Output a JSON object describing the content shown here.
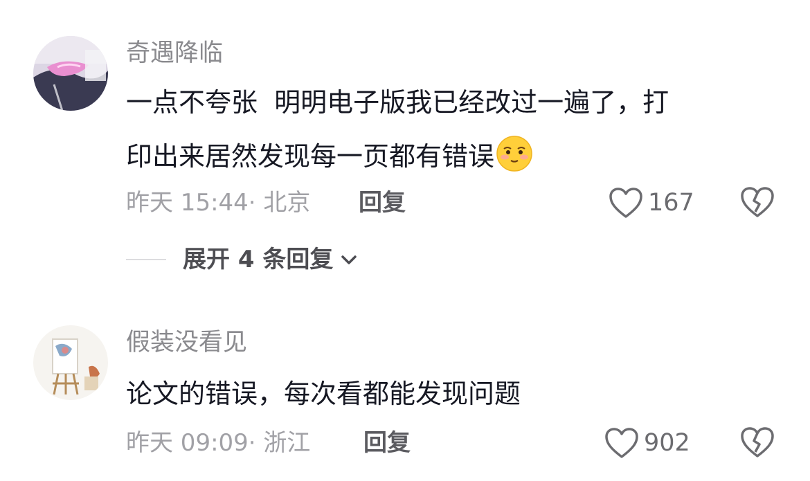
{
  "comments": [
    {
      "username": "奇遇降临",
      "content": "一点不夸张  明明电子版我已经改过一遍了，打\n印出来居然发现每一页都有错误",
      "emoji": "shy-smile-emoji",
      "time_location": "昨天 15:44· 北京",
      "reply_label": "回复",
      "likes": "167",
      "expand_label": "展开 4 条回复"
    },
    {
      "username": "假装没看见",
      "content": "论文的错误，每次看都能发现问题",
      "time_location": "昨天 09:09· 浙江",
      "reply_label": "回复",
      "likes": "902"
    }
  ],
  "colors": {
    "username": "#8a8a8e",
    "content": "#161823",
    "meta": "#a1a1a6",
    "icon": "#6c6c70"
  }
}
